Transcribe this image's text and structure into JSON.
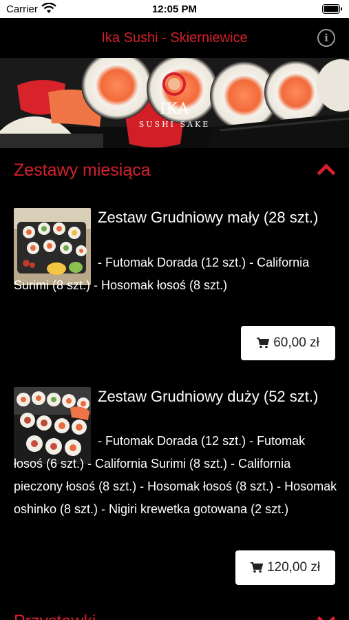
{
  "status_bar": {
    "carrier": "Carrier",
    "time": "12:05 PM"
  },
  "header": {
    "title": "Ika Sushi - Skierniewice",
    "info_icon": "info-icon"
  },
  "banner": {
    "logo_name": "IKA",
    "logo_sub": "SUSHI SAKE"
  },
  "sections": [
    {
      "title": "Zestawy miesiąca",
      "expanded": true,
      "products": [
        {
          "title": "Zestaw Grudniowy mały (28 szt.)",
          "description": "- Futomak Dorada (12 szt.) - California Surimi (8 szt.) - Hosomak łosoś (8 szt.)",
          "price": "60,00 zł"
        },
        {
          "title": "Zestaw Grudniowy duży (52 szt.)",
          "description": "- Futomak Dorada (12 szt.) - Futomak łosoś (6 szt.) - California Surimi (8 szt.) - California pieczony łosoś (8 szt.) - Hosomak łosoś (8 szt.) - Hosomak oshinko (8 szt.) - Nigiri krewetka gotowana (2 szt.)",
          "price": "120,00 zł"
        }
      ]
    },
    {
      "title": "Przystawki",
      "expanded": false
    }
  ],
  "colors": {
    "accent": "#d51f2c",
    "background": "#000000",
    "button_bg": "#ffffff"
  }
}
